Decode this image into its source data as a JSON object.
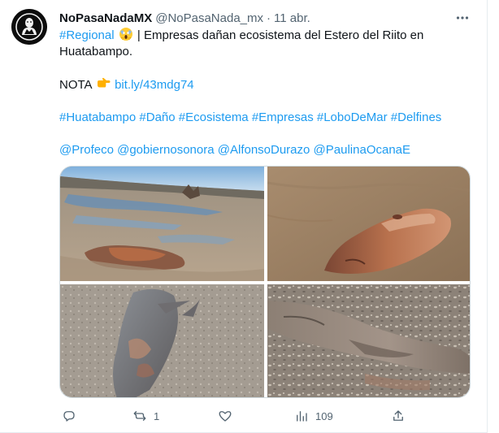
{
  "tweet": {
    "display_name": "NoPasaNadaMX",
    "handle": "@NoPasaNada_mx",
    "separator": "·",
    "time": "11 abr.",
    "more_icon": "more-dots-icon",
    "body": {
      "hashtag_regional": "#Regional",
      "emoji_1": "face-screaming-icon",
      "text_1a": "| Empresas dañan ecosistema del Estero del Riito en",
      "text_1b": "Huatabampo.",
      "nota_label": "NOTA",
      "emoji_2": "pointing-right-icon",
      "link": "bit.ly/43mdg74",
      "hashtags": [
        "#Huatabampo",
        "#Daño",
        "#Ecosistema",
        "#Empresas",
        "#LoboDeMar",
        "#Delfines"
      ],
      "mentions": [
        "@Profeco",
        "@gobiernosonora",
        "@AlfonsoDurazo",
        "@PaulinaOcanaE"
      ]
    },
    "actions": {
      "reply_icon": "reply-icon",
      "reply_count": "",
      "retweet_icon": "retweet-icon",
      "retweet_count": "1",
      "like_icon": "heart-icon",
      "like_count": "",
      "views_icon": "views-chart-icon",
      "views_count": "109",
      "share_icon": "share-icon"
    }
  },
  "colors": {
    "link": "#1d9bf0",
    "text": "#0f1419",
    "secondary": "#536471",
    "border": "#cfd9de"
  }
}
